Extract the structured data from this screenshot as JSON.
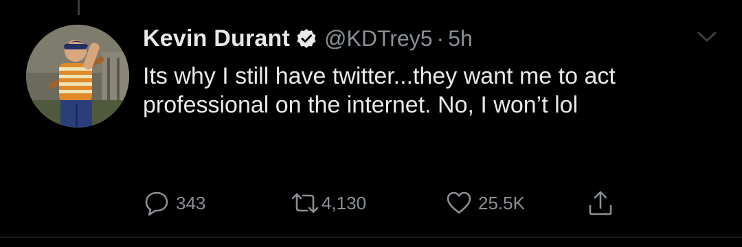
{
  "tweet": {
    "display_name": "Kevin Durant",
    "handle": "@KDTrey5",
    "separator": "·",
    "time": "5h",
    "text": "Its why I still have twitter...they want me to act professional on the internet. No, I won’t lol",
    "verified": true
  },
  "actions": {
    "reply_count": "343",
    "retweet_count": "4,130",
    "like_count": "25.5K"
  },
  "icons": {
    "reply": "reply-icon",
    "retweet": "retweet-icon",
    "like": "heart-icon",
    "share": "share-icon",
    "more": "chevron-down-icon",
    "verified": "verified-badge-icon"
  },
  "colors": {
    "background": "#000000",
    "text": "#e7e9ea",
    "muted": "#8b9096"
  }
}
